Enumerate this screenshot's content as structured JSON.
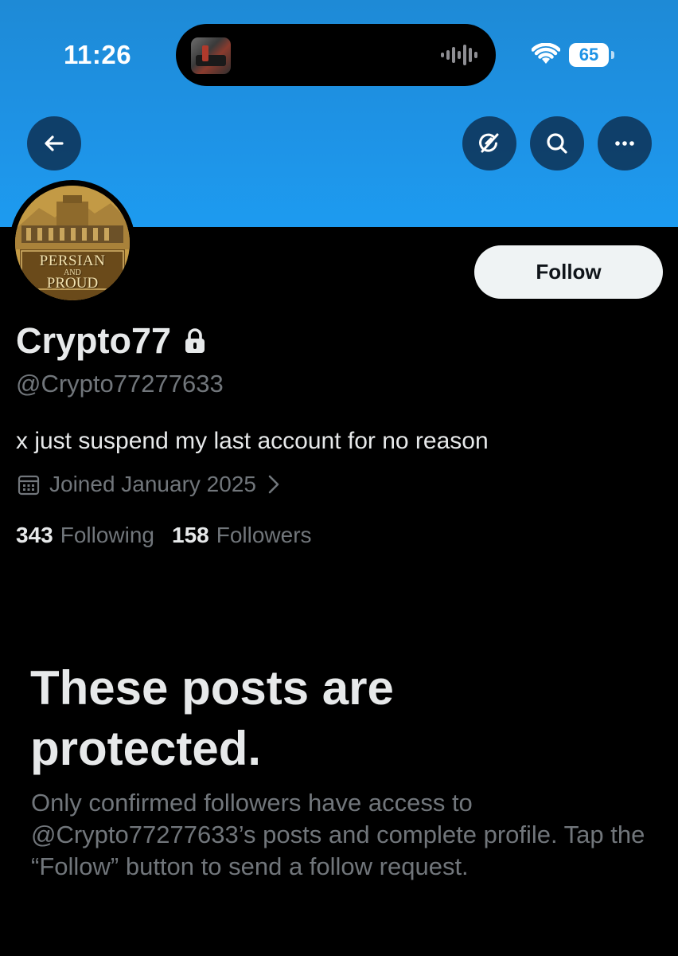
{
  "status_bar": {
    "time": "11:26",
    "battery": "65"
  },
  "nav": {
    "back_icon": "arrow-left-icon",
    "grok_icon": "grok-icon",
    "search_icon": "search-icon",
    "more_icon": "more-horizontal-icon"
  },
  "avatar": {
    "line1": "PERSIAN",
    "line2": "AND",
    "line3": "PROUD"
  },
  "profile": {
    "follow_label": "Follow",
    "display_name": "Crypto77",
    "handle": "@Crypto77277633",
    "bio": "x just suspend my last account for no reason",
    "joined": "Joined January 2025",
    "following_count": "343",
    "following_label": "Following",
    "followers_count": "158",
    "followers_label": "Followers"
  },
  "protected": {
    "title": "These posts are protected.",
    "body": "Only confirmed followers have access to @Crypto77277633’s posts and complete profile. Tap the “Follow” button to send a follow request."
  },
  "colors": {
    "banner": "#1d9bf0",
    "background": "#000000",
    "primary_text": "#e7e9ea",
    "secondary_text": "#71767b",
    "follow_button_bg": "#eff3f4"
  }
}
